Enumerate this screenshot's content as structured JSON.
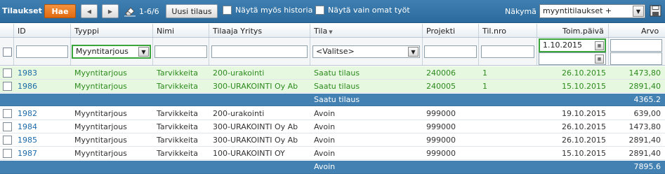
{
  "toolbar": {
    "title": "Tilaukset",
    "search_label": "Hae",
    "prev_icon": "arrow-left-icon",
    "next_icon": "arrow-right-icon",
    "clear_icon": "eraser-icon",
    "count": "1-6/6",
    "new_order_label": "Uusi tilaus",
    "show_history_label": "Näytä myös historia",
    "show_own_label": "Näytä vain omat työt",
    "view_label": "Näkymä",
    "view_value": "myyntitilaukset +",
    "save_icon": "floppy-disk-icon"
  },
  "columns": [
    "ID",
    "Tyyppi",
    "Nimi",
    "Tilaaja Yritys",
    "Tila",
    "Projekti",
    "Til.nro",
    "Toim.päivä",
    "Arvo"
  ],
  "filters": {
    "tyyppi": "Myyntitarjous",
    "tila": "<Valitse>",
    "toim_paiva_from": "1.10.2015"
  },
  "groups": [
    {
      "status": "Saatu tilaus",
      "total": "4365.2",
      "rows": [
        {
          "id": "1983",
          "tyyppi": "Myyntitarjous",
          "nimi": "Tarvikkeita",
          "yritys": "200-urakointi",
          "tila": "Saatu tilaus",
          "projekti": "240006",
          "tilnro": "1",
          "toim": "26.10.2015",
          "arvo": "1473,80"
        },
        {
          "id": "1986",
          "tyyppi": "Myyntitarjous",
          "nimi": "Tarvikkeita",
          "yritys": "300-URAKOINTI Oy Ab",
          "tila": "Saatu tilaus",
          "projekti": "240005",
          "tilnro": "1",
          "toim": "15.10.2015",
          "arvo": "2891,40"
        }
      ]
    },
    {
      "status": "Avoin",
      "total": "7895.6",
      "rows": [
        {
          "id": "1982",
          "tyyppi": "Myyntitarjous",
          "nimi": "Tarvikkeita",
          "yritys": "200-urakointi",
          "tila": "Avoin",
          "projekti": "999000",
          "tilnro": "",
          "toim": "19.10.2015",
          "arvo": "639,00"
        },
        {
          "id": "1984",
          "tyyppi": "Myyntitarjous",
          "nimi": "Tarvikkeita",
          "yritys": "300-URAKOINTI Oy Ab",
          "tila": "Avoin",
          "projekti": "999000",
          "tilnro": "",
          "toim": "26.10.2015",
          "arvo": "1473,80"
        },
        {
          "id": "1985",
          "tyyppi": "Myyntitarjous",
          "nimi": "Tarvikkeita",
          "yritys": "300-URAKOINTI Oy Ab",
          "tila": "Avoin",
          "projekti": "999000",
          "tilnro": "",
          "toim": "26.10.2015",
          "arvo": "2891,40"
        },
        {
          "id": "1987",
          "tyyppi": "Myyntitarjous",
          "nimi": "Tarvikkeita",
          "yritys": "100-URAKOINTI OY",
          "tila": "Avoin",
          "projekti": "999000",
          "tilnro": "",
          "toim": "15.10.2015",
          "arvo": "2891,40"
        }
      ]
    }
  ],
  "colors": {
    "toolbar_bg": "#3a79ab",
    "search_button": "#f07e1e",
    "group_row": "#4381b3",
    "won_row_bg": "#e6f9e0",
    "won_text": "#2d8a1e",
    "id_link": "#1c6aa8",
    "active_filter_border": "#3aa53a"
  }
}
